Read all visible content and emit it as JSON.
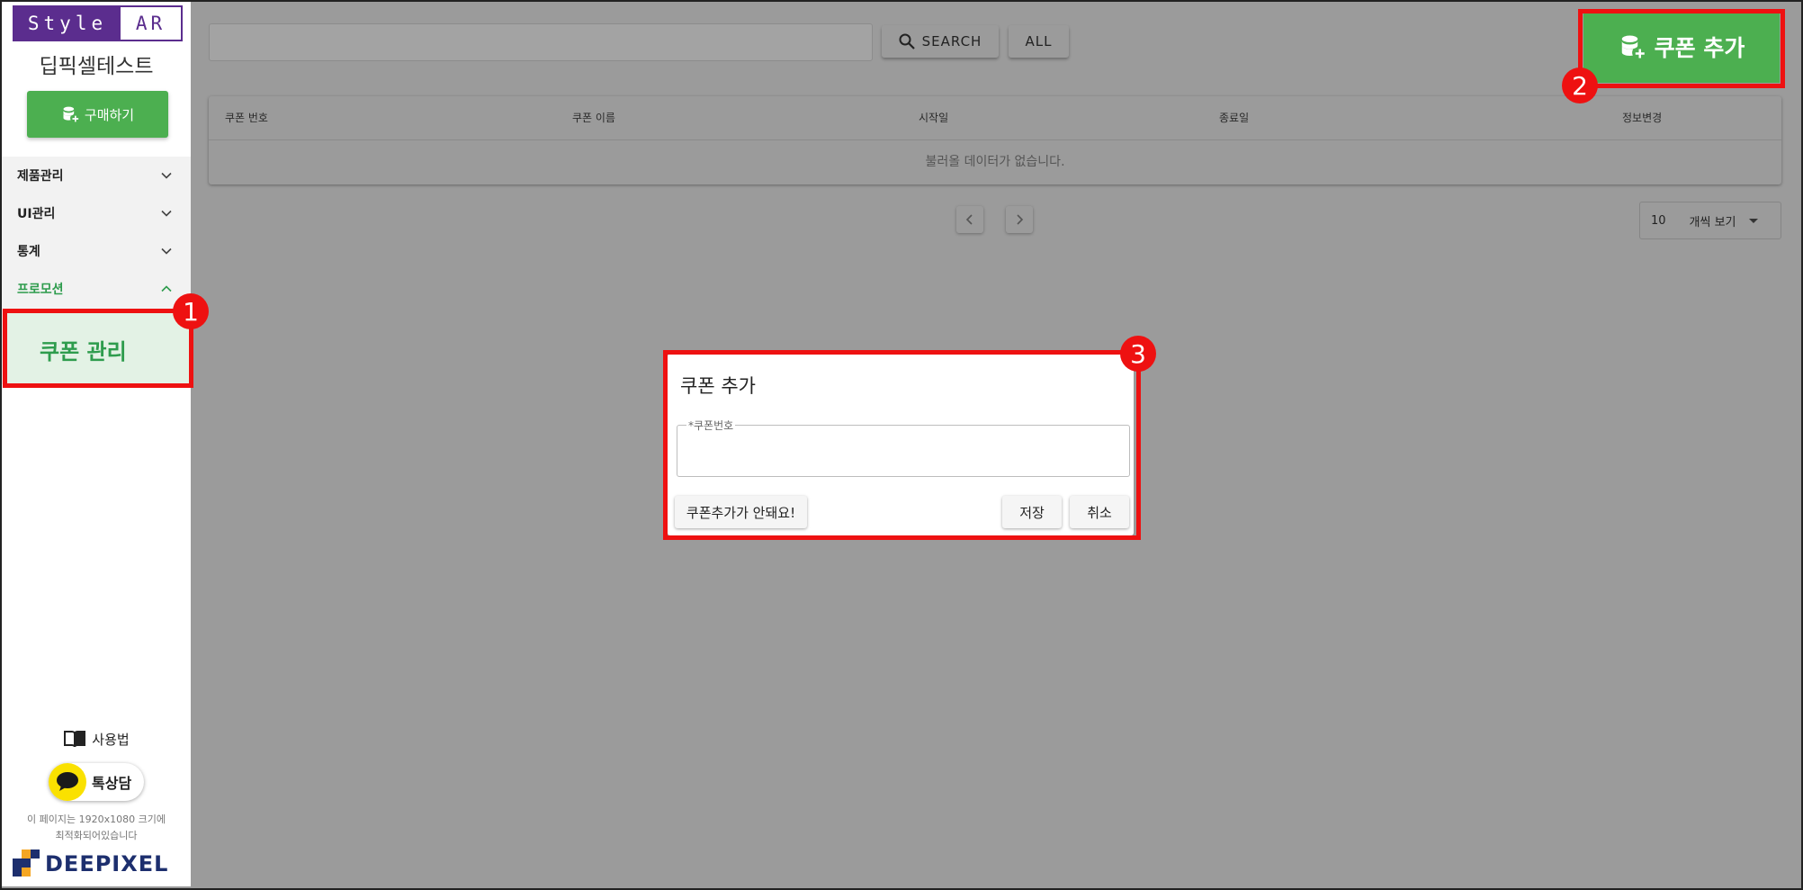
{
  "sidebar": {
    "logo_left": "Style",
    "logo_right": "AR",
    "shop_name": "딥픽셀테스트",
    "buy_button": "구매하기",
    "menu": [
      {
        "label": "제품관리",
        "expanded": false
      },
      {
        "label": "UI관리",
        "expanded": false
      },
      {
        "label": "통계",
        "expanded": false
      },
      {
        "label": "프로모션",
        "expanded": true
      }
    ],
    "submenu_item": "쿠폰 관리",
    "help_label": "사용법",
    "talk_label": "톡상담",
    "notice_line1": "이 페이지는 1920x1080 크기에",
    "notice_line2": "최적화되어있습니다",
    "brand": "DEEPIXEL"
  },
  "toolbar": {
    "search_value": "",
    "search_button": "SEARCH",
    "all_button": "ALL",
    "add_coupon_button": "쿠폰 추가"
  },
  "table": {
    "columns": [
      "쿠폰 번호",
      "쿠폰 이름",
      "시작일",
      "종료일",
      "정보변경"
    ],
    "empty_message": "불러올 데이터가 없습니다."
  },
  "pagination": {
    "per_page_value": "10",
    "per_page_label": "개씩 보기"
  },
  "dialog": {
    "title": "쿠폰 추가",
    "field_label": "*쿠폰번호",
    "field_value": "",
    "help_button": "쿠폰추가가 안돼요!",
    "save_button": "저장",
    "cancel_button": "취소"
  },
  "callouts": [
    "1",
    "2",
    "3"
  ],
  "colors": {
    "accent_green": "#4caf50",
    "brand_purple": "#5b2d8e",
    "highlight_red": "#ee1111",
    "kakao_yellow": "#fae100"
  }
}
